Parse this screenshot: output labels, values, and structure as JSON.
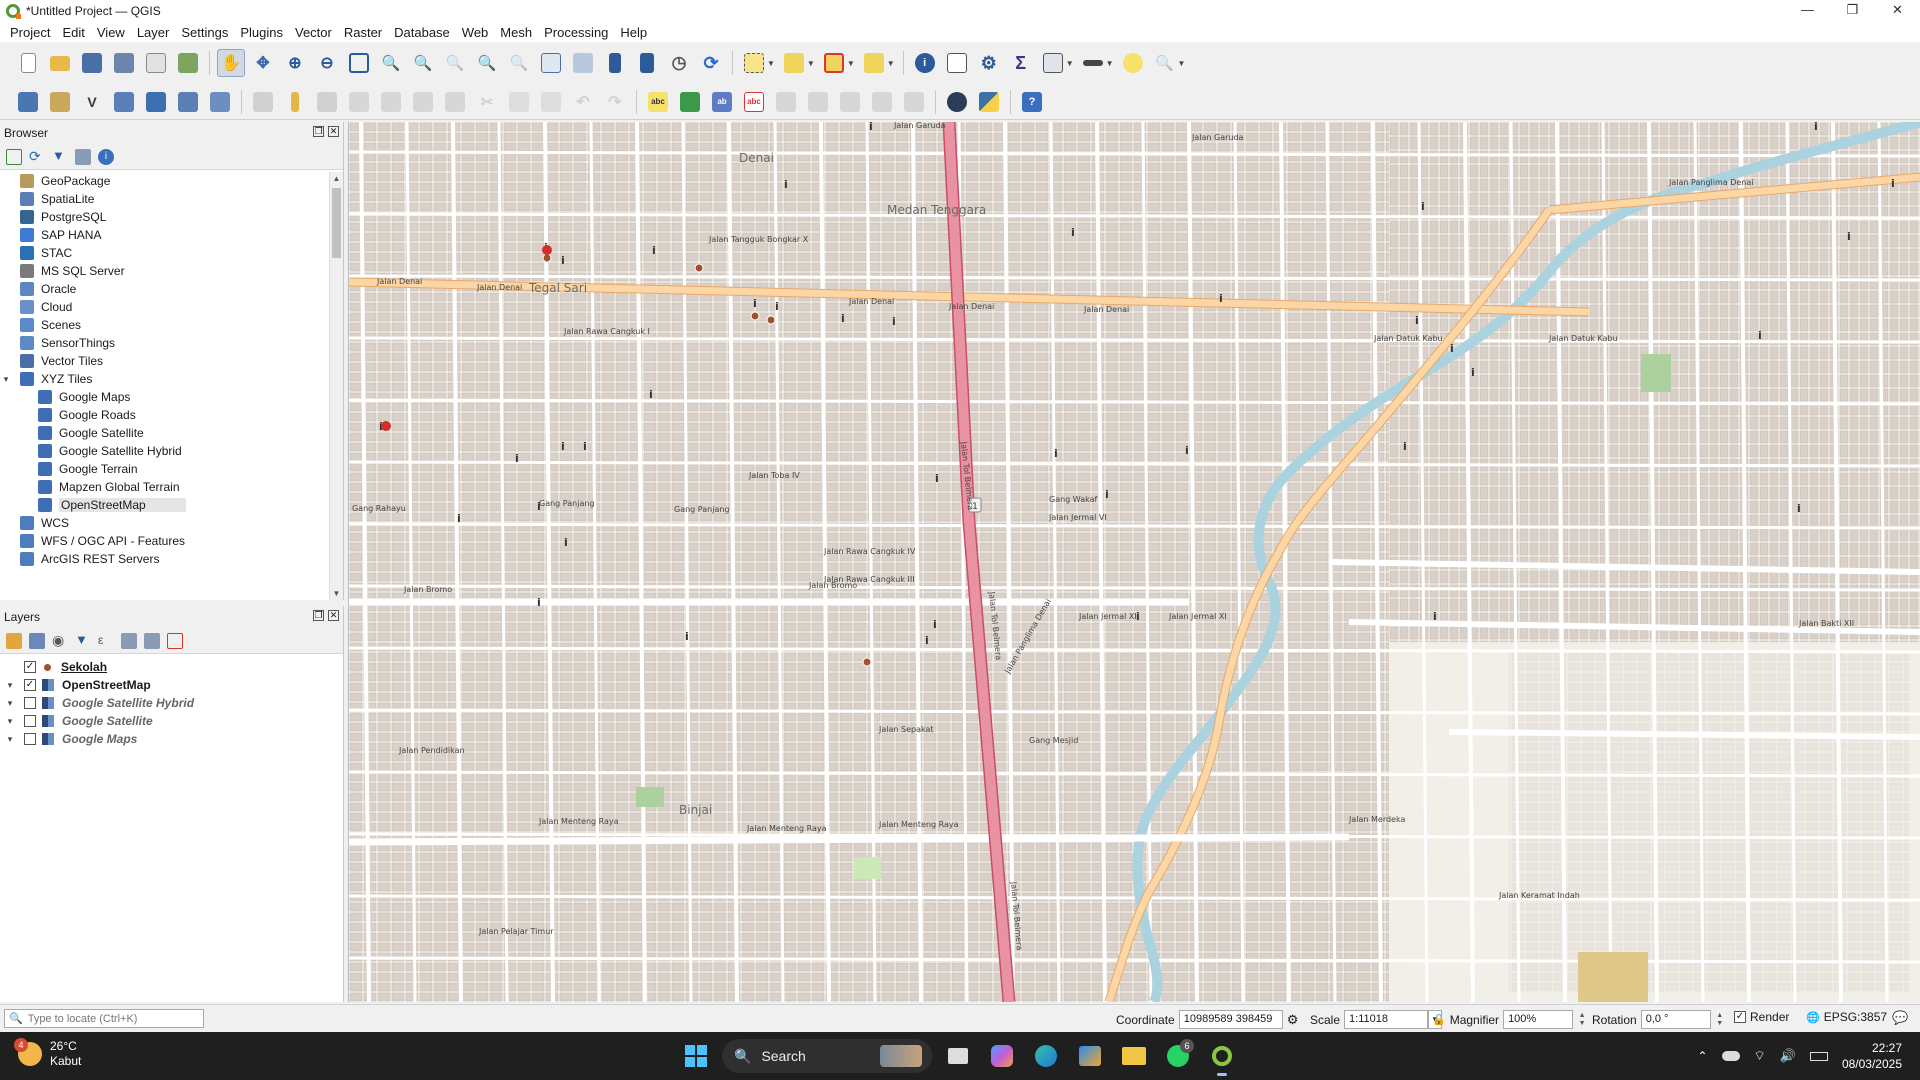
{
  "window": {
    "title": "*Untitled Project — QGIS",
    "minimize": "—",
    "maximize": "❐",
    "close": "✕"
  },
  "menu": [
    "Project",
    "Edit",
    "View",
    "Layer",
    "Settings",
    "Plugins",
    "Vector",
    "Raster",
    "Database",
    "Web",
    "Mesh",
    "Processing",
    "Help"
  ],
  "browser": {
    "title": "Browser",
    "items": [
      {
        "label": "GeoPackage",
        "icon": "geopackage-icon",
        "color": "#b89a5a"
      },
      {
        "label": "SpatiaLite",
        "icon": "spatialite-icon",
        "color": "#5b7fb8"
      },
      {
        "label": "PostgreSQL",
        "icon": "postgresql-icon",
        "color": "#336791"
      },
      {
        "label": "SAP HANA",
        "icon": "sap-hana-icon",
        "color": "#3d7ad6"
      },
      {
        "label": "STAC",
        "icon": "stac-icon",
        "color": "#2c6fb5"
      },
      {
        "label": "MS SQL Server",
        "icon": "mssql-icon",
        "color": "#7a7a7a"
      },
      {
        "label": "Oracle",
        "icon": "oracle-icon",
        "color": "#5d86c2"
      },
      {
        "label": "Cloud",
        "icon": "cloud-icon",
        "color": "#6b8fc7"
      },
      {
        "label": "Scenes",
        "icon": "scenes-icon",
        "color": "#5b8acb"
      },
      {
        "label": "SensorThings",
        "icon": "sensorthings-icon",
        "color": "#5a8bc4"
      },
      {
        "label": "Vector Tiles",
        "icon": "vector-tiles-icon",
        "color": "#4a6ea8"
      },
      {
        "label": "XYZ Tiles",
        "icon": "xyz-tiles-icon",
        "color": "#3e6fb5",
        "expanded": true
      },
      {
        "label": "Google Maps",
        "icon": "tile-grid-icon",
        "color": "#3e6fb5",
        "child": true
      },
      {
        "label": "Google Roads",
        "icon": "tile-grid-icon",
        "color": "#3e6fb5",
        "child": true
      },
      {
        "label": "Google Satellite",
        "icon": "tile-grid-icon",
        "color": "#3e6fb5",
        "child": true
      },
      {
        "label": "Google Satellite Hybrid",
        "icon": "tile-grid-icon",
        "color": "#3e6fb5",
        "child": true
      },
      {
        "label": "Google Terrain",
        "icon": "tile-grid-icon",
        "color": "#3e6fb5",
        "child": true
      },
      {
        "label": "Mapzen Global Terrain",
        "icon": "tile-grid-icon",
        "color": "#3e6fb5",
        "child": true
      },
      {
        "label": "OpenStreetMap",
        "icon": "tile-grid-icon",
        "color": "#3e6fb5",
        "child": true,
        "selected": true
      },
      {
        "label": "WCS",
        "icon": "wcs-icon",
        "color": "#4d7dbf"
      },
      {
        "label": "WFS / OGC API - Features",
        "icon": "wfs-icon",
        "color": "#4d7dbf"
      },
      {
        "label": "ArcGIS REST Servers",
        "icon": "arcgis-icon",
        "color": "#4d7dbf"
      }
    ]
  },
  "layers": {
    "title": "Layers",
    "items": [
      {
        "name": "Sekolah",
        "checked": true,
        "style": "bold underline",
        "icon": "point-layer-icon",
        "expand": ""
      },
      {
        "name": "OpenStreetMap",
        "checked": true,
        "style": "bold",
        "icon": "raster-layer-icon",
        "expand": "▾"
      },
      {
        "name": "Google Satellite Hybrid",
        "checked": false,
        "style": "italic",
        "icon": "raster-layer-icon",
        "expand": "▾"
      },
      {
        "name": "Google Satellite",
        "checked": false,
        "style": "italic",
        "icon": "raster-layer-icon",
        "expand": "▾"
      },
      {
        "name": "Google Maps",
        "checked": false,
        "style": "italic",
        "icon": "raster-layer-icon",
        "expand": "▾"
      }
    ]
  },
  "map": {
    "places": [
      {
        "label": "Denai"
      },
      {
        "label": "Medan Tenggara"
      },
      {
        "label": "Tegal Sari"
      },
      {
        "label": "Binjai"
      }
    ],
    "streets": {
      "jalan_denai": "Jalan Denai",
      "tol_belmera": "Jalan Tol Belmera",
      "jalan_menteng_raya": "Jalan Menteng Raya",
      "jalan_bromo": "Jalan Bromo",
      "jalan_sepakat": "Jalan Sepakat",
      "jalan_panglima_denai": "Jalan Panglima Denai",
      "jalan_rawa_cangkuk_iii": "Jalan Rawa Cangkuk III",
      "jalan_rawa_cangkuk_iv": "Jalan Rawa Cangkuk IV",
      "jalan_toba_iv": "Jalan Toba IV",
      "jalan_tangguk_bongkar_x": "Jalan Tangguk Bongkar X",
      "jalan_datuk_kabu": "Jalan Datuk Kabu",
      "jalan_jermal_vi": "Jalan Jermal VI",
      "jalan_jermal_xi": "Jalan Jermal XI",
      "jalan_bakti_xii": "Jalan Bakti XII",
      "jalan_merdeka": "Jalan Merdeka",
      "jalan_keramat_indah": "Jalan Keramat Indah",
      "jalan_pendidikan": "Jalan Pendidikan",
      "jalan_pelajar_timur": "Jalan Pelajar Timur",
      "gang_panjang": "Gang Panjang",
      "gang_rahayu": "Gang Rahayu",
      "gang_wakaf": "Gang Wakaf",
      "gang_mesjid": "Gang Mesjid",
      "jalan_garuda": "Jalan Garuda",
      "jalan_rawa_cangkuk_i": "Jalan Rawa Cangkuk I"
    },
    "road_shield": "1",
    "colors": {
      "background": "#f2efe9",
      "primary": "#fcd6a4",
      "motorway": "#e892a2",
      "river": "#aad3df",
      "building": "#d9d0c9"
    }
  },
  "status": {
    "locator_placeholder": "Type to locate (Ctrl+K)",
    "coordinate_label": "Coordinate",
    "coordinate_value": "10989589 398459",
    "scale_label": "Scale",
    "scale_value": "1:11018",
    "magnifier_label": "Magnifier",
    "magnifier_value": "100%",
    "rotation_label": "Rotation",
    "rotation_value": "0,0 °",
    "render_label": "Render",
    "crs": "EPSG:3857"
  },
  "taskbar": {
    "weather_temp": "26°C",
    "weather_desc": "Kabut",
    "weather_badge": "4",
    "search_label": "Search",
    "whatsapp_badge": "6",
    "time": "22:27",
    "date": "08/03/2025"
  }
}
